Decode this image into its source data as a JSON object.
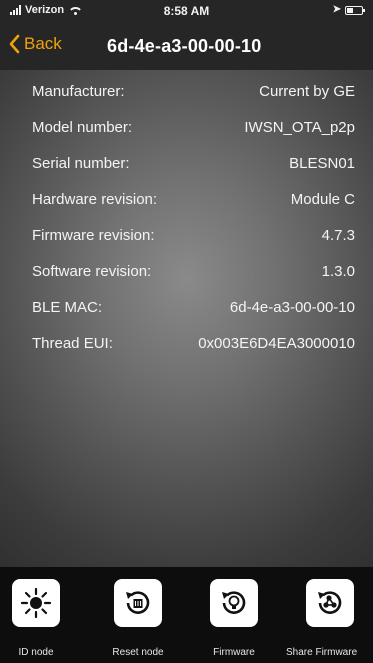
{
  "status_bar": {
    "carrier": "Verizon",
    "time": "8:58 AM"
  },
  "nav": {
    "back_label": "Back",
    "title": "6d-4e-a3-00-00-10"
  },
  "device_info": [
    {
      "label": "Manufacturer:",
      "value": "Current by GE"
    },
    {
      "label": "Model number:",
      "value": "IWSN_OTA_p2p"
    },
    {
      "label": "Serial number:",
      "value": "BLESN01"
    },
    {
      "label": "Hardware revision:",
      "value": "Module C"
    },
    {
      "label": "Firmware revision:",
      "value": "4.7.3"
    },
    {
      "label": "Software revision:",
      "value": "1.3.0"
    },
    {
      "label": "BLE MAC:",
      "value": "6d-4e-a3-00-00-10"
    },
    {
      "label": "Thread EUI:",
      "value": "0x003E6D4EA3000010"
    }
  ],
  "tabs": [
    {
      "label": "ID node",
      "icon": "sun-icon"
    },
    {
      "label": "Reset node",
      "icon": "reset-node-icon"
    },
    {
      "label": "Firmware",
      "icon": "firmware-icon"
    },
    {
      "label": "Share Firmware",
      "icon": "share-firmware-icon"
    }
  ],
  "colors": {
    "accent": "#f0a20d",
    "bar_background": "#262626",
    "tab_bar_background": "#0d0d0d"
  }
}
